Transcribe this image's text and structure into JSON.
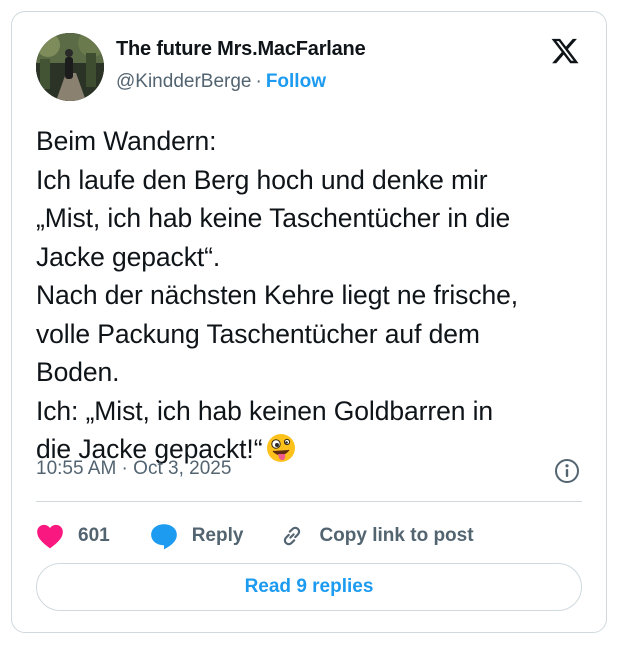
{
  "author": {
    "name": "The future Mrs.MacFarlane",
    "handle": "@KindderBerge",
    "separator": "·",
    "follow_label": "Follow"
  },
  "tweet": {
    "lines": [
      "Beim Wandern:",
      "Ich laufe den Berg hoch und denke mir",
      "„Mist, ich hab keine Taschentücher in die",
      "Jacke gepackt“.",
      "Nach der nächsten Kehre liegt ne frische,",
      "volle Packung Taschentücher auf dem",
      "Boden.",
      "Ich: „Mist, ich hab keinen Goldbarren in",
      "die Jacke gepackt!“"
    ],
    "emoji": "zany-face-emoji",
    "timestamp": "10:55 AM · Oct 3, 2025"
  },
  "actions": {
    "like_count": "601",
    "reply_label": "Reply",
    "copy_label": "Copy link to post"
  },
  "read_replies_label": "Read 9 replies",
  "icons": {
    "logo": "x-logo-icon",
    "info": "info-icon",
    "like": "heart-icon",
    "reply": "reply-bubble-icon",
    "copy": "link-icon"
  },
  "colors": {
    "accent": "#1d9bf0",
    "like": "#f91880",
    "muted": "#536471",
    "text": "#0f1419",
    "border": "#cfd9de"
  }
}
